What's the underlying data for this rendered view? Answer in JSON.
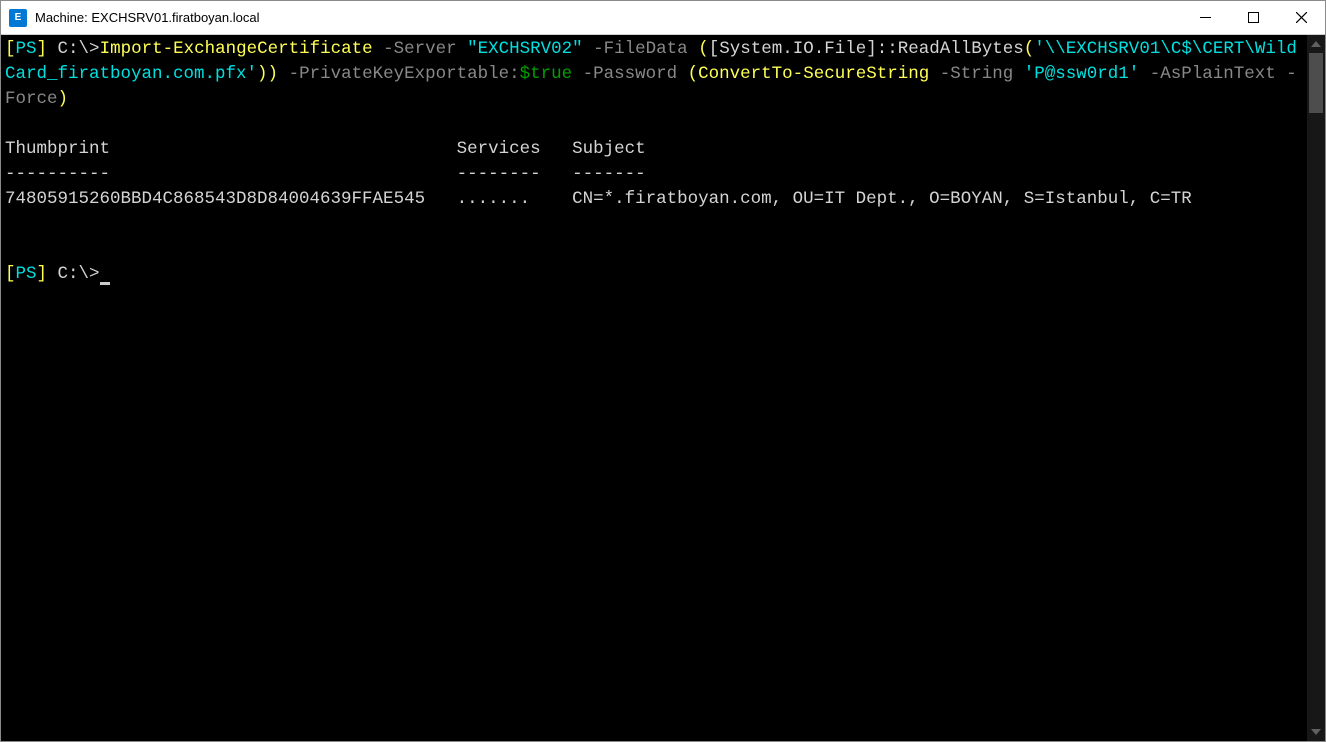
{
  "window": {
    "title": "Machine: EXCHSRV01.firatboyan.local",
    "app_icon_text": "E"
  },
  "terminal": {
    "prompt1": {
      "ps_open": "[",
      "ps": "PS",
      "ps_close": "]",
      "path": " C:\\>",
      "cmd": "Import-ExchangeCertificate",
      "p_server": " -Server ",
      "v_server": "\"EXCHSRV02\"",
      "p_filedata": " -FileData ",
      "paren_open": "(",
      "bracket_type": "[System.IO.File]",
      "double_colon": "::",
      "method": "ReadAllBytes",
      "m_open": "(",
      "path_str": "'\\\\EXCHSRV01\\C$\\CERT\\WildCard_firatboyan.com.pfx'",
      "m_close": "))",
      "p_pke": " -PrivateKeyExportable:",
      "v_true": "$true",
      "p_password": " -Password ",
      "paren2_open": "(",
      "convert_cmd": "ConvertTo-SecureString",
      "p_string": " -String ",
      "v_string": "'P@ssw0rd1'",
      "p_plain": " -AsPlainText",
      "p_force": " -Force",
      "paren2_close": ")"
    },
    "output": {
      "header_thumbprint": "Thumbprint",
      "header_services": "Services",
      "header_subject": "Subject",
      "dash_thumbprint": "----------",
      "dash_services": "--------",
      "dash_subject": "-------",
      "row_thumbprint": "74805915260BBD4C868543D8D84004639FFAE545",
      "row_services": ".......",
      "row_subject": "CN=*.firatboyan.com, OU=IT Dept., O=BOYAN, S=Istanbul, C=TR"
    },
    "prompt2": {
      "ps_open": "[",
      "ps": "PS",
      "ps_close": "]",
      "path": " C:\\>"
    }
  }
}
